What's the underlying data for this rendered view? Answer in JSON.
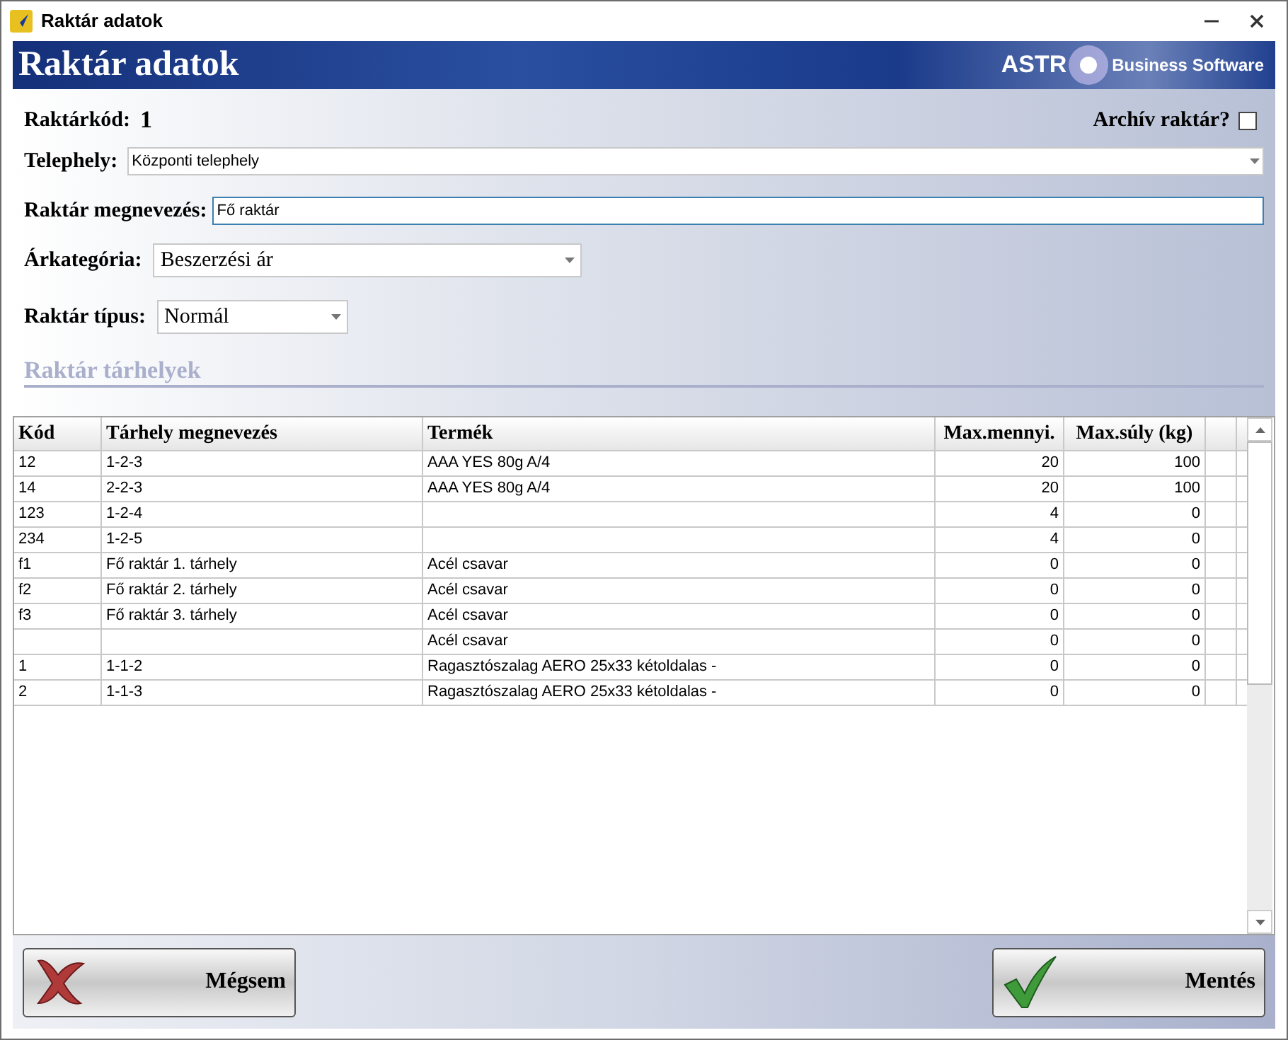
{
  "window": {
    "title": "Raktár adatok"
  },
  "banner": {
    "title": "Raktár adatok",
    "brand": "ASTR",
    "tagline": "Business Software"
  },
  "form": {
    "code_label": "Raktárkód:",
    "code_value": "1",
    "archive_label": "Archív raktár?",
    "archive_checked": false,
    "site_label": "Telephely:",
    "site_value": "Központi telephely",
    "name_label": "Raktár megnevezés:",
    "name_value": "Fő raktár",
    "price_label": "Árkategória:",
    "price_value": "Beszerzési ár",
    "type_label": "Raktár típus:",
    "type_value": "Normál"
  },
  "section_title": "Raktár tárhelyek",
  "table": {
    "columns": [
      "Kód",
      "Tárhely megnevezés",
      "Termék",
      "Max.mennyi.",
      "Max.súly (kg)"
    ],
    "rows": [
      [
        "12",
        "1-2-3",
        "AAA YES 80g A/4",
        "20",
        "100"
      ],
      [
        "14",
        "2-2-3",
        "AAA YES 80g A/4",
        "20",
        "100"
      ],
      [
        "123",
        "1-2-4",
        "",
        "4",
        "0"
      ],
      [
        "234",
        "1-2-5",
        "",
        "4",
        "0"
      ],
      [
        "f1",
        "Fő raktár 1. tárhely",
        "Acél csavar",
        "0",
        "0"
      ],
      [
        "f2",
        "Fő raktár 2. tárhely",
        "Acél csavar",
        "0",
        "0"
      ],
      [
        "f3",
        "Fő raktár 3. tárhely",
        "Acél csavar",
        "0",
        "0"
      ],
      [
        "",
        "",
        "Acél csavar",
        "0",
        "0"
      ],
      [
        "1",
        "1-1-2",
        "Ragasztószalag AERO 25x33 kétoldalas -",
        "0",
        "0"
      ],
      [
        "2",
        "1-1-3",
        "Ragasztószalag AERO 25x33 kétoldalas -",
        "0",
        "0"
      ]
    ]
  },
  "buttons": [
    {
      "label": "Mégsem",
      "kind": "cancel"
    },
    {
      "label": "Mentés",
      "kind": "save"
    }
  ]
}
